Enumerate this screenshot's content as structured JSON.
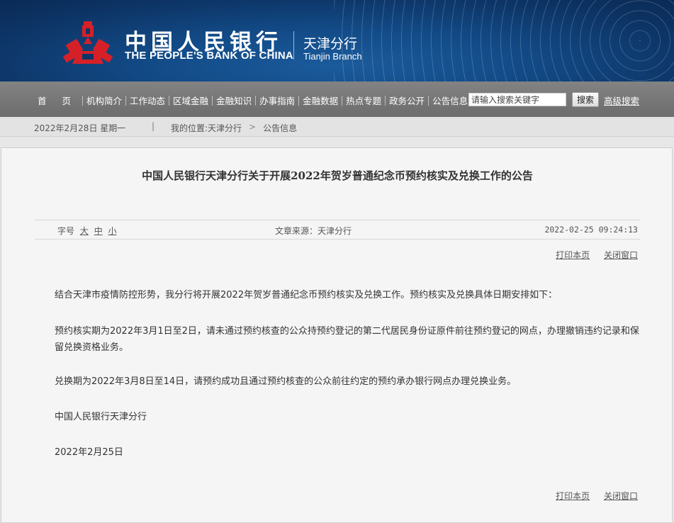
{
  "header": {
    "bank_name_cn": "中国人民银行",
    "bank_name_en": "THE PEOPLE'S BANK OF CHINA",
    "branch_cn": "天津分行",
    "branch_en": "Tianjin Branch",
    "logo_icon": "pboc-logo-icon",
    "logo_color": "#d62028"
  },
  "nav": {
    "items": [
      "首页",
      "机构简介",
      "工作动态",
      "区域金融",
      "金融知识",
      "办事指南",
      "金融数据",
      "热点专题",
      "政务公开",
      "公告信息"
    ],
    "search_placeholder": "请输入搜索关键字",
    "search_button": "搜索",
    "advanced_search": "高级搜索"
  },
  "infobar": {
    "date": "2022年2月28日 星期一",
    "separator": "|",
    "location_label": "我的位置:天津分行",
    "crumb_arrow": ">",
    "current": "公告信息"
  },
  "article": {
    "title": "中国人民银行天津分行关于开展2022年贺岁普通纪念币预约核实及兑换工作的公告",
    "font_size_label": "字号",
    "font_size_options": [
      "大",
      "中",
      "小"
    ],
    "source": "文章来源：天津分行",
    "datetime": "2022-02-25 09:24:13",
    "print_label": "打印本页",
    "close_label": "关闭窗口",
    "paragraphs": [
      "结合天津市疫情防控形势，我分行将开展2022年贺岁普通纪念币预约核实及兑换工作。预约核实及兑换具体日期安排如下：",
      "预约核实期为2022年3月1日至2日，请未通过预约核查的公众持预约登记的第二代居民身份证原件前往预约登记的网点，办理撤销违约记录和保留兑换资格业务。",
      "兑换期为2022年3月8日至14日，请预约成功且通过预约核查的公众前往约定的预约承办银行网点办理兑换业务。",
      "中国人民银行天津分行",
      "2022年2月25日"
    ]
  }
}
